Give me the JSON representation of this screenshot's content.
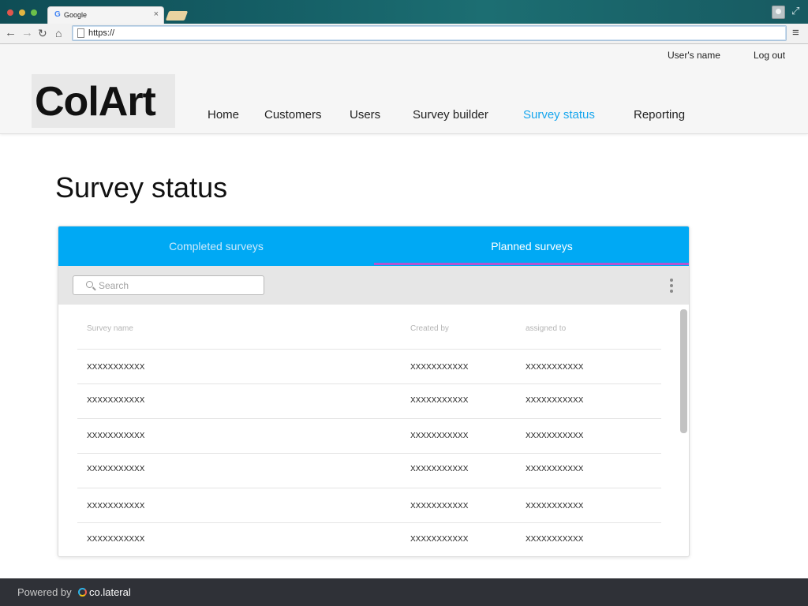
{
  "browser": {
    "tab_title": "Google",
    "tab_close": "×",
    "address": "https://",
    "icons": [
      "back-arrow-icon",
      "forward-arrow-icon",
      "reload-icon",
      "home-icon",
      "hamburger-menu-icon",
      "user-profile-icon",
      "expand-icon"
    ]
  },
  "header": {
    "user_name": "User's name",
    "logout": "Log out",
    "logo": "ColArt",
    "nav": [
      {
        "label": "Home",
        "active": false
      },
      {
        "label": "Customers",
        "active": false
      },
      {
        "label": "Users",
        "active": false
      },
      {
        "label": "Survey builder",
        "active": false
      },
      {
        "label": "Survey status",
        "active": true
      },
      {
        "label": "Reporting",
        "active": false
      }
    ]
  },
  "page": {
    "title": "Survey status",
    "tabs": [
      {
        "label": "Completed surveys",
        "active": false
      },
      {
        "label": "Planned surveys",
        "active": true
      }
    ],
    "search": {
      "placeholder": "Search",
      "value": ""
    },
    "table": {
      "columns": [
        "Survey name",
        "Created by",
        "assigned to"
      ],
      "rows": [
        [
          "XXXXXXXXXXX",
          "XXXXXXXXXXX",
          "XXXXXXXXXXX"
        ],
        [
          "XXXXXXXXXXX",
          "XXXXXXXXXXX",
          "XXXXXXXXXXX"
        ],
        [
          "XXXXXXXXXXX",
          "XXXXXXXXXXX",
          "XXXXXXXXXXX"
        ],
        [
          "XXXXXXXXXXX",
          "XXXXXXXXXXX",
          "XXXXXXXXXXX"
        ],
        [
          "XXXXXXXXXXX",
          "XXXXXXXXXXX",
          "XXXXXXXXXXX"
        ],
        [
          "XXXXXXXXXXX",
          "XXXXXXXXXXX",
          "XXXXXXXXXXX"
        ]
      ]
    }
  },
  "footer": {
    "powered_by": "Powered by",
    "brand": "co.lateral"
  },
  "colors": {
    "accent": "#00a9f4",
    "active_nav": "#17a6ee",
    "tab_indicator": "#b455cf",
    "footer_bg": "#2f3137"
  }
}
